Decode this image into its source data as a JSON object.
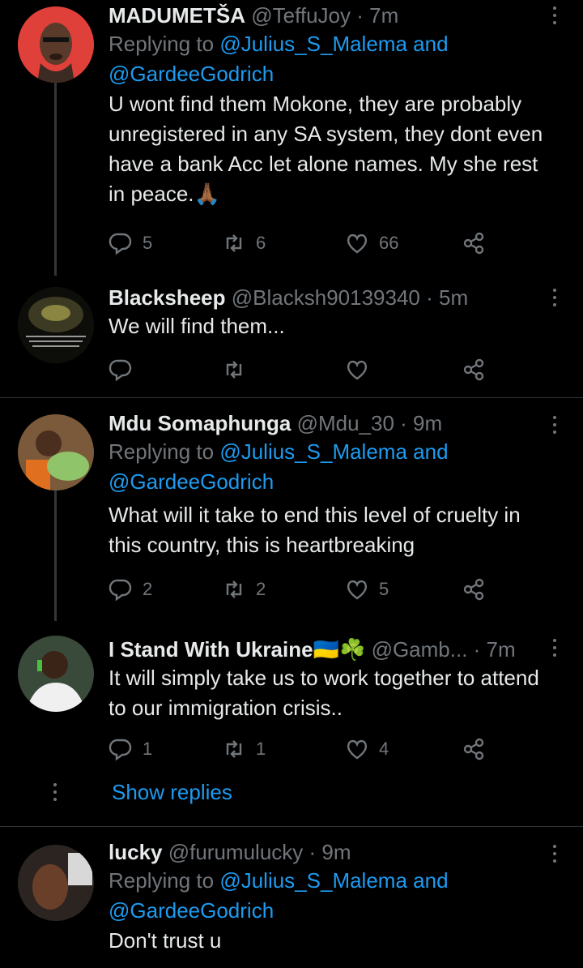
{
  "tweets": [
    {
      "name": "MADUMETŠA",
      "handle": "@TeffuJoy",
      "time": "· 7m",
      "replying_prefix": "Replying to",
      "replying_to_1": "@Julius_S_Malema",
      "replying_and": "and",
      "replying_to_2": "@GardeeGodrich",
      "text": "U wont find them Mokone, they are probably unregistered in any SA system, they dont even have a bank Acc let alone names. My she rest in peace.🙏🏾",
      "replies": "5",
      "retweets": "6",
      "likes": "66"
    },
    {
      "name": "Blacksheep",
      "handle": "@Blacksh90139340",
      "time": "· 5m",
      "text": "We will find them...",
      "replies": "",
      "retweets": "",
      "likes": ""
    },
    {
      "name": "Mdu Somaphunga",
      "handle": "@Mdu_30",
      "time": "· 9m",
      "replying_prefix": "Replying to",
      "replying_to_1": "@Julius_S_Malema",
      "replying_and": "and",
      "replying_to_2": "@GardeeGodrich",
      "text": "What will it take to end this level of cruelty in this country, this is heartbreaking",
      "replies": "2",
      "retweets": "2",
      "likes": "5"
    },
    {
      "name": "I Stand With Ukraine🇺🇦☘️",
      "handle": "@Gamb...",
      "time": "· 7m",
      "text": "It will simply take us to work together to attend to our immigration crisis..",
      "replies": "1",
      "retweets": "1",
      "likes": "4"
    },
    {
      "name": "lucky",
      "handle": "@furumulucky",
      "time": "· 9m",
      "replying_prefix": "Replying to",
      "replying_to_1": "@Julius_S_Malema",
      "replying_and": "and",
      "replying_to_2": "@GardeeGodrich",
      "text": "Don't trust u"
    }
  ],
  "show_replies_label": "Show replies",
  "colors": {
    "background": "#000000",
    "link": "#1d9bf0",
    "muted": "#71767b",
    "text": "#e7e9ea"
  },
  "icons": [
    "reply-icon",
    "retweet-icon",
    "like-icon",
    "share-icon",
    "more-icon"
  ]
}
